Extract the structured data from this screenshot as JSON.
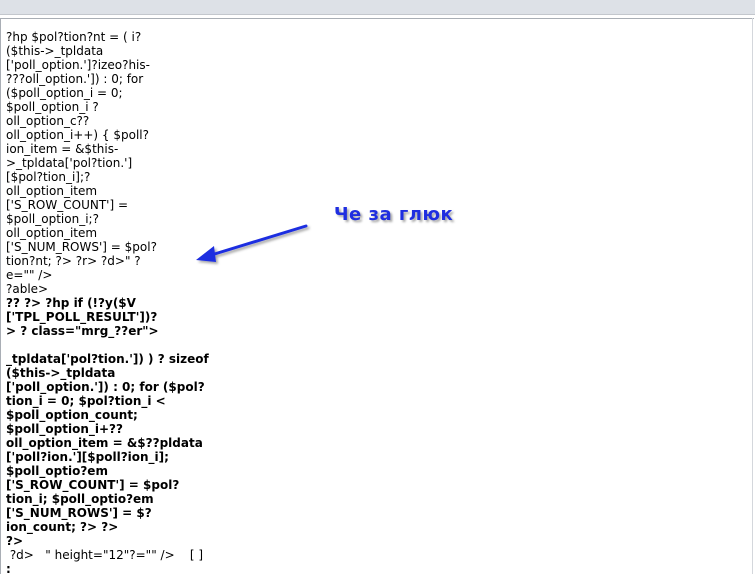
{
  "annotation": {
    "text": "Че за глюк",
    "color": "#1f2ee0"
  },
  "code_lines": [
    {
      "text": "?hp $pol?tion?nt = ( i?",
      "bold": false
    },
    {
      "text": "($this->_tpldata",
      "bold": false
    },
    {
      "text": "['poll_option.']?izeo?his-",
      "bold": false
    },
    {
      "text": "???oll_option.']) : 0; for",
      "bold": false
    },
    {
      "text": "($poll_option_i = 0;",
      "bold": false
    },
    {
      "text": "$poll_option_i ?",
      "bold": false
    },
    {
      "text": "oll_option_c??",
      "bold": false
    },
    {
      "text": "oll_option_i++) { $poll?",
      "bold": false
    },
    {
      "text": "ion_item = &$this-",
      "bold": false
    },
    {
      "text": ">_tpldata['pol?tion.']",
      "bold": false
    },
    {
      "text": "[$pol?tion_i];?",
      "bold": false
    },
    {
      "text": "oll_option_item",
      "bold": false
    },
    {
      "text": "['S_ROW_COUNT'] =",
      "bold": false
    },
    {
      "text": "$poll_option_i;?",
      "bold": false
    },
    {
      "text": "oll_option_item",
      "bold": false
    },
    {
      "text": "['S_NUM_ROWS'] = $pol?",
      "bold": false
    },
    {
      "text": "tion?nt; ?> ?r> ?d>\" ?",
      "bold": false
    },
    {
      "text": "e=\"\" />",
      "bold": false
    },
    {
      "text": "?able>",
      "bold": false
    },
    {
      "text": "?? ?> ?hp if (!?y($V",
      "bold": true
    },
    {
      "text": "['TPL_POLL_RESULT'])?",
      "bold": true
    },
    {
      "text": "> ? class=\"mrg_??er\">",
      "bold": true
    },
    {
      "text": "",
      "bold": true
    },
    {
      "text": "_tpldata['pol?tion.']) ) ? sizeof",
      "bold": true
    },
    {
      "text": "($this->_tpldata",
      "bold": true
    },
    {
      "text": "['poll_option.']) : 0; for ($pol?",
      "bold": true
    },
    {
      "text": "tion_i = 0; $pol?tion_i <",
      "bold": true
    },
    {
      "text": "$poll_option_count;",
      "bold": true
    },
    {
      "text": "$poll_option_i+??",
      "bold": true
    },
    {
      "text": "oll_option_item = &$??pldata",
      "bold": true
    },
    {
      "text": "['poll?ion.'][$poll?ion_i];",
      "bold": true
    },
    {
      "text": "$poll_optio?em",
      "bold": true
    },
    {
      "text": "['S_ROW_COUNT'] = $pol?",
      "bold": true
    },
    {
      "text": "tion_i; $poll_optio?em",
      "bold": true
    },
    {
      "text": "['S_NUM_ROWS'] = $?",
      "bold": true
    },
    {
      "text": "ion_count; ?> ?>",
      "bold": true
    },
    {
      "text": "?>",
      "bold": true
    },
    {
      "text": " ?d>   \" height=\"12\"?=\"\" />    [ ]",
      "bold": false
    },
    {
      "text": ":",
      "bold": true
    }
  ]
}
